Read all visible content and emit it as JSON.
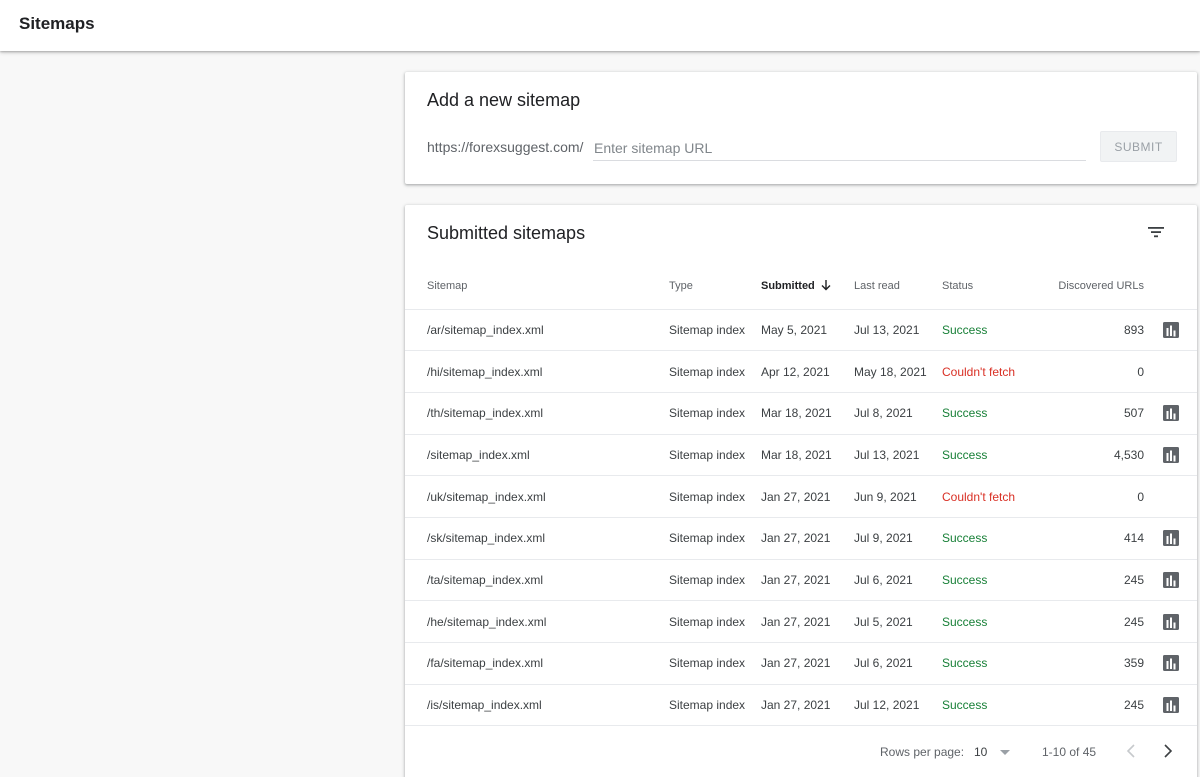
{
  "header": {
    "title": "Sitemaps"
  },
  "add_sitemap": {
    "title": "Add a new sitemap",
    "prefix": "https://forexsuggest.com/",
    "input_placeholder": "Enter sitemap URL",
    "input_value": "",
    "submit_label": "SUBMIT"
  },
  "submitted": {
    "title": "Submitted sitemaps",
    "filter_icon": "filter-list-icon",
    "columns": {
      "sitemap": "Sitemap",
      "type": "Type",
      "submitted": "Submitted",
      "last_read": "Last read",
      "status": "Status",
      "discovered": "Discovered URLs"
    },
    "rows": [
      {
        "sitemap": "/ar/sitemap_index.xml",
        "type": "Sitemap index",
        "submitted": "May 5, 2021",
        "last_read": "Jul 13, 2021",
        "status": "Success",
        "discovered": "893",
        "has_chart": true
      },
      {
        "sitemap": "/hi/sitemap_index.xml",
        "type": "Sitemap index",
        "submitted": "Apr 12, 2021",
        "last_read": "May 18, 2021",
        "status": "Couldn't fetch",
        "discovered": "0",
        "has_chart": false
      },
      {
        "sitemap": "/th/sitemap_index.xml",
        "type": "Sitemap index",
        "submitted": "Mar 18, 2021",
        "last_read": "Jul 8, 2021",
        "status": "Success",
        "discovered": "507",
        "has_chart": true
      },
      {
        "sitemap": "/sitemap_index.xml",
        "type": "Sitemap index",
        "submitted": "Mar 18, 2021",
        "last_read": "Jul 13, 2021",
        "status": "Success",
        "discovered": "4,530",
        "has_chart": true
      },
      {
        "sitemap": "/uk/sitemap_index.xml",
        "type": "Sitemap index",
        "submitted": "Jan 27, 2021",
        "last_read": "Jun 9, 2021",
        "status": "Couldn't fetch",
        "discovered": "0",
        "has_chart": false
      },
      {
        "sitemap": "/sk/sitemap_index.xml",
        "type": "Sitemap index",
        "submitted": "Jan 27, 2021",
        "last_read": "Jul 9, 2021",
        "status": "Success",
        "discovered": "414",
        "has_chart": true
      },
      {
        "sitemap": "/ta/sitemap_index.xml",
        "type": "Sitemap index",
        "submitted": "Jan 27, 2021",
        "last_read": "Jul 6, 2021",
        "status": "Success",
        "discovered": "245",
        "has_chart": true
      },
      {
        "sitemap": "/he/sitemap_index.xml",
        "type": "Sitemap index",
        "submitted": "Jan 27, 2021",
        "last_read": "Jul 5, 2021",
        "status": "Success",
        "discovered": "245",
        "has_chart": true
      },
      {
        "sitemap": "/fa/sitemap_index.xml",
        "type": "Sitemap index",
        "submitted": "Jan 27, 2021",
        "last_read": "Jul 6, 2021",
        "status": "Success",
        "discovered": "359",
        "has_chart": true
      },
      {
        "sitemap": "/is/sitemap_index.xml",
        "type": "Sitemap index",
        "submitted": "Jan 27, 2021",
        "last_read": "Jul 12, 2021",
        "status": "Success",
        "discovered": "245",
        "has_chart": true
      }
    ],
    "pager": {
      "rows_per_page_label": "Rows per page:",
      "rows_per_page_value": "10",
      "range": "1-10 of 45"
    }
  },
  "colors": {
    "success": "#188038",
    "error": "#d93025",
    "icon": "#5f6368"
  }
}
